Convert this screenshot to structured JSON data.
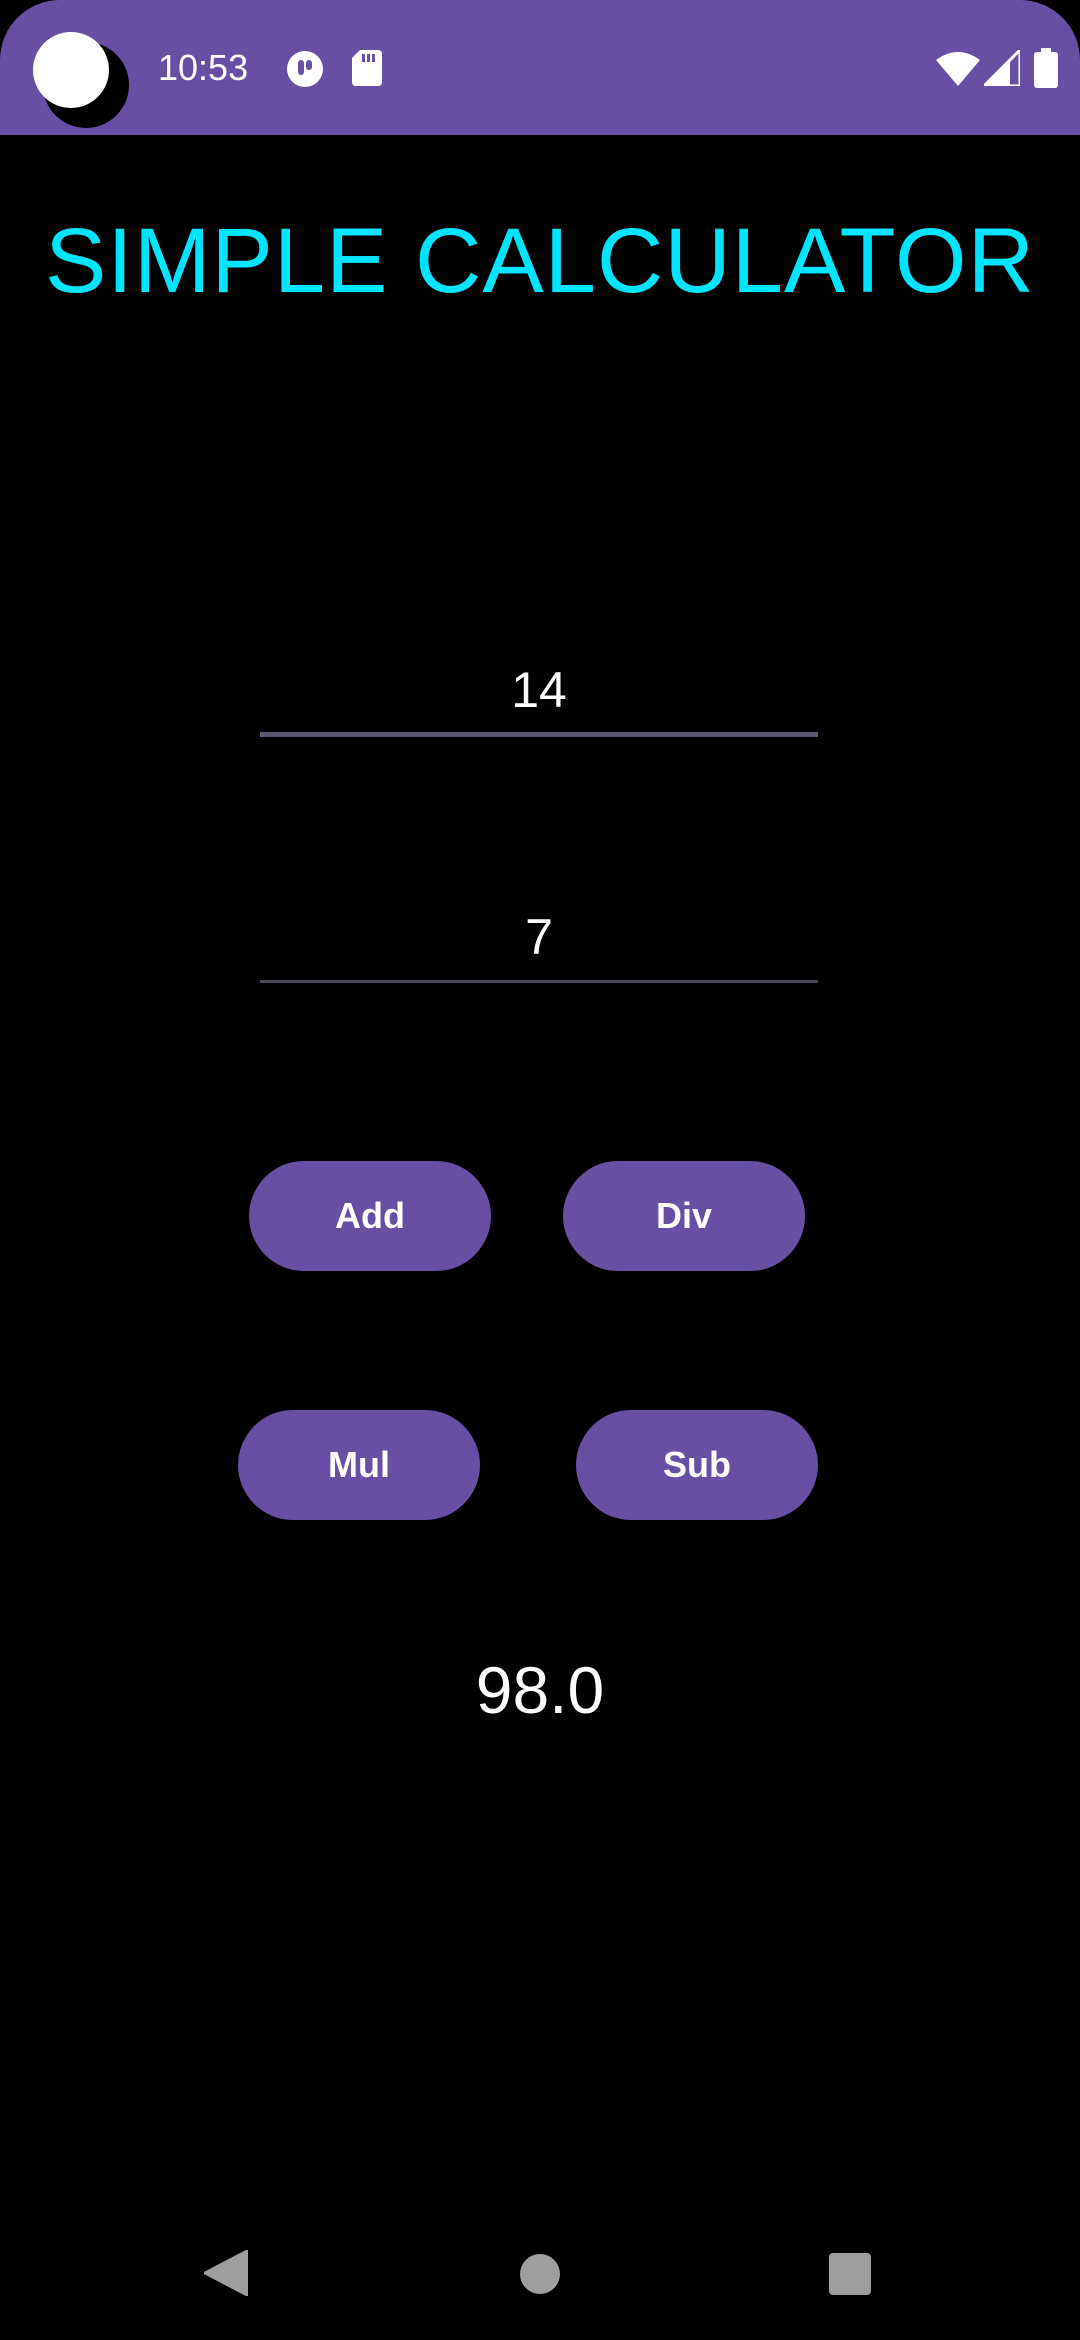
{
  "status_bar": {
    "time": "10:53",
    "color": "#6750A4",
    "left_icons": [
      "notification-badge-icon",
      "sd-card-icon"
    ],
    "right_icons": [
      "wifi-icon",
      "signal-icon",
      "battery-icon"
    ]
  },
  "app": {
    "title": "SIMPLE CALCULATOR",
    "title_color": "#00E5FF",
    "first_number": "14",
    "second_number": "7",
    "buttons": {
      "add": "Add",
      "div": "Div",
      "mul": "Mul",
      "sub": "Sub"
    },
    "button_color": "#6750A4",
    "result": "98.0"
  },
  "nav_bar": {
    "icons": [
      "back-icon",
      "home-icon",
      "recents-icon"
    ]
  }
}
